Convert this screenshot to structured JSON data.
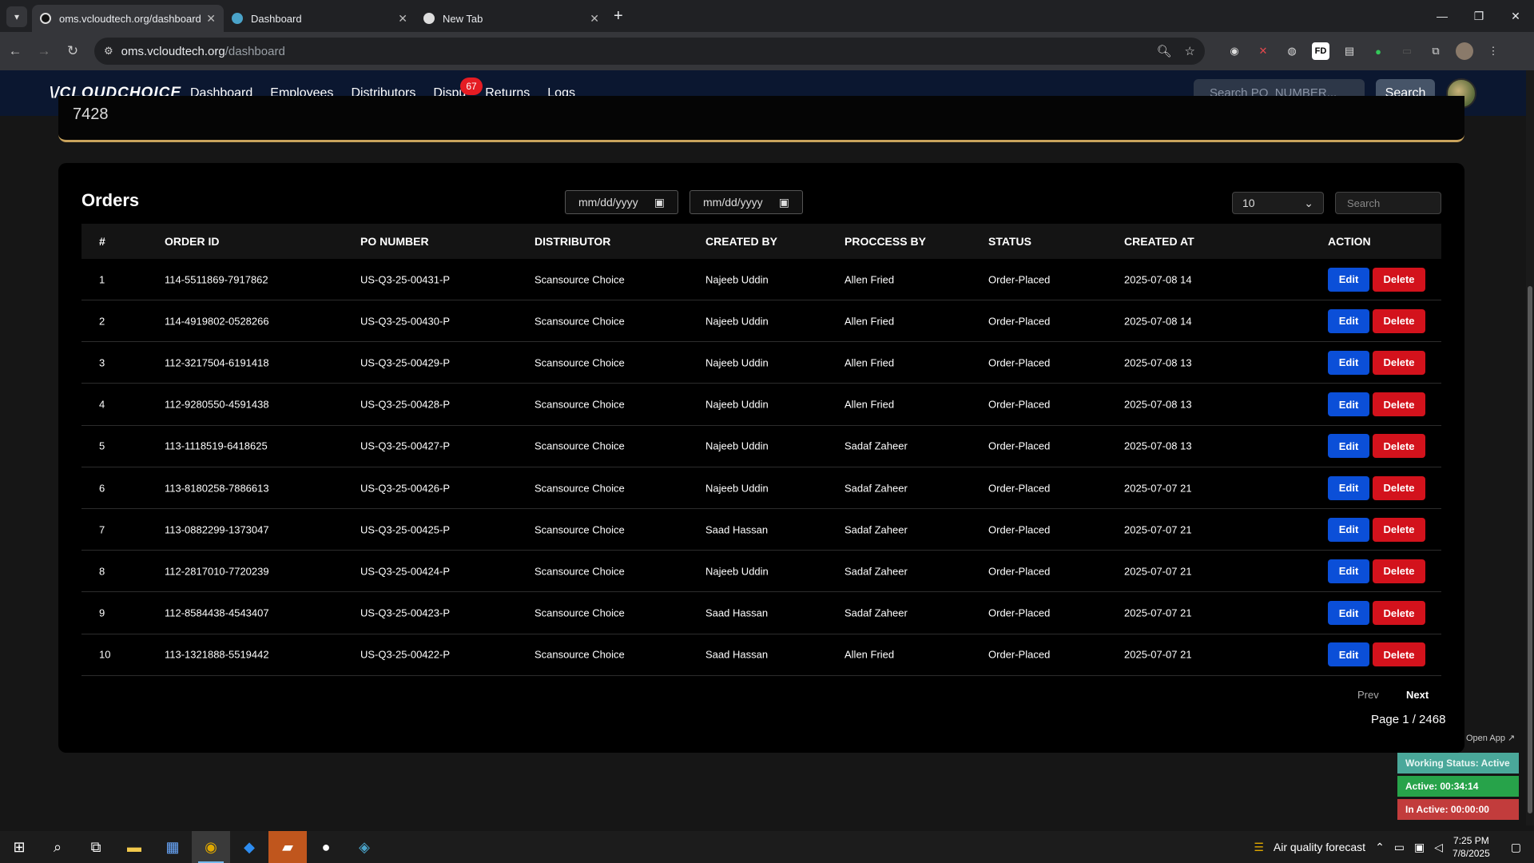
{
  "browser": {
    "tabs": [
      {
        "title": "oms.vcloudtech.org/dashboard",
        "active": true
      },
      {
        "title": "Dashboard",
        "active": false
      },
      {
        "title": "New Tab",
        "active": false
      }
    ],
    "url_site": "oms.vcloudtech.org",
    "url_path": "/dashboard"
  },
  "app": {
    "logo": "\\/CLOUDCHOICE",
    "nav": [
      "Dashboard",
      "Employees",
      "Distributors",
      "Dispu",
      "Returns",
      "Logs"
    ],
    "dispute_badge": "67",
    "search_placeholder": "Search PO_NUMBER...",
    "search_button": "Search",
    "top_card_value": "7428"
  },
  "orders": {
    "title": "Orders",
    "date_from": "mm/dd/yyyy",
    "date_to": "mm/dd/yyyy",
    "per_page": "10",
    "search_placeholder": "Search",
    "columns": [
      "#",
      "ORDER ID",
      "PO NUMBER",
      "DISTRIBUTOR",
      "CREATED BY",
      "PROCCESS BY",
      "STATUS",
      "CREATED AT",
      "ACTION"
    ],
    "rows": [
      [
        "1",
        "114-5511869-7917862",
        "US-Q3-25-00431-P",
        "Scansource Choice",
        "Najeeb Uddin",
        "Allen Fried",
        "Order-Placed",
        "2025-07-08 14"
      ],
      [
        "2",
        "114-4919802-0528266",
        "US-Q3-25-00430-P",
        "Scansource Choice",
        "Najeeb Uddin",
        "Allen Fried",
        "Order-Placed",
        "2025-07-08 14"
      ],
      [
        "3",
        "112-3217504-6191418",
        "US-Q3-25-00429-P",
        "Scansource Choice",
        "Najeeb Uddin",
        "Allen Fried",
        "Order-Placed",
        "2025-07-08 13"
      ],
      [
        "4",
        "112-9280550-4591438",
        "US-Q3-25-00428-P",
        "Scansource Choice",
        "Najeeb Uddin",
        "Allen Fried",
        "Order-Placed",
        "2025-07-08 13"
      ],
      [
        "5",
        "113-1118519-6418625",
        "US-Q3-25-00427-P",
        "Scansource Choice",
        "Najeeb Uddin",
        "Sadaf Zaheer",
        "Order-Placed",
        "2025-07-08 13"
      ],
      [
        "6",
        "113-8180258-7886613",
        "US-Q3-25-00426-P",
        "Scansource Choice",
        "Najeeb Uddin",
        "Sadaf Zaheer",
        "Order-Placed",
        "2025-07-07 21"
      ],
      [
        "7",
        "113-0882299-1373047",
        "US-Q3-25-00425-P",
        "Scansource Choice",
        "Saad Hassan",
        "Sadaf Zaheer",
        "Order-Placed",
        "2025-07-07 21"
      ],
      [
        "8",
        "112-2817010-7720239",
        "US-Q3-25-00424-P",
        "Scansource Choice",
        "Najeeb Uddin",
        "Sadaf Zaheer",
        "Order-Placed",
        "2025-07-07 21"
      ],
      [
        "9",
        "112-8584438-4543407",
        "US-Q3-25-00423-P",
        "Scansource Choice",
        "Saad Hassan",
        "Sadaf Zaheer",
        "Order-Placed",
        "2025-07-07 21"
      ],
      [
        "10",
        "113-1321888-5519442",
        "US-Q3-25-00422-P",
        "Scansource Choice",
        "Saad Hassan",
        "Allen Fried",
        "Order-Placed",
        "2025-07-07 21"
      ]
    ],
    "edit_label": "Edit",
    "delete_label": "Delete",
    "prev_label": "Prev",
    "next_label": "Next",
    "page_info": "Page 1 / 2468"
  },
  "widget": {
    "open_app": "Open App ↗",
    "working_status": "Working Status: Active",
    "active_time": "Active: 00:34:14",
    "inactive_time": "In Active: 00:00:00"
  },
  "taskbar": {
    "weather": "Air quality forecast",
    "time": "7:25 PM",
    "date": "7/8/2025"
  },
  "icons": {
    "tab_favicon": "globe-icon",
    "search": "magnifier-icon",
    "calendar": "calendar-icon"
  },
  "colors": {
    "nav_bg": "#0b1730",
    "edit": "#0b4fd8",
    "delete": "#d3121c",
    "badge": "#e51c23",
    "accent": "#c9a35c"
  }
}
